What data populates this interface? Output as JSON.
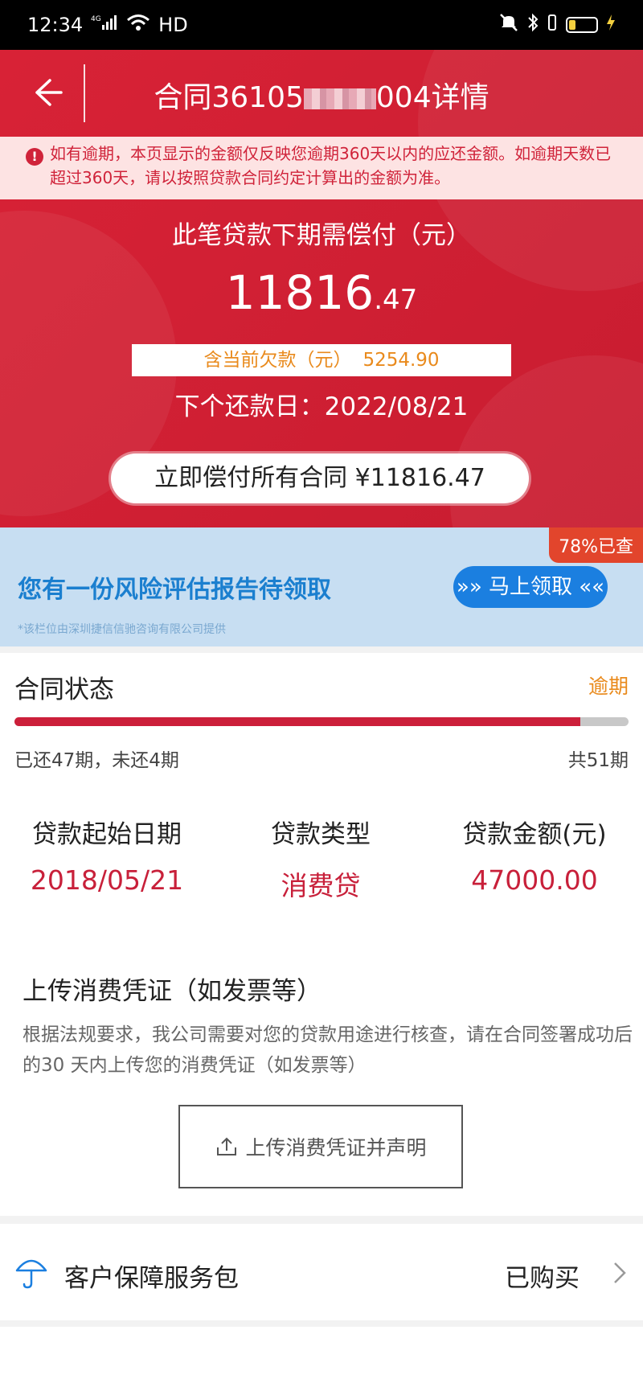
{
  "status_bar": {
    "time": "12:34",
    "network": "HD"
  },
  "header": {
    "title_prefix": "合同36105",
    "title_suffix": "004详情"
  },
  "notice": {
    "text": "如有逾期，本页显示的金额仅反映您逾期360天以内的应还金额。如逾期天数已超过360天，请以按照贷款合同约定计算出的金额为准。"
  },
  "summary": {
    "due_label": "此笔贷款下期需偿付（元）",
    "amount_int": "11816",
    "amount_dec": ".47",
    "arrears_label": "含当前欠款（元）",
    "arrears_value": "5254.90",
    "next_date": "下个还款日：2022/08/21",
    "pay_button": "立即偿付所有合同 ¥11816.47"
  },
  "banner": {
    "tag": "78%已查",
    "title": "您有一份风险评估报告待领取",
    "button": "»» 马上领取 ««",
    "note": "*该栏位由深圳捷信信驰咨询有限公司提供"
  },
  "contract": {
    "title": "合同状态",
    "status": "逾期",
    "progress_fraction": 0.9216,
    "paid_text": "已还47期，未还4期",
    "total_text": "共51期",
    "info": [
      {
        "label": "贷款起始日期",
        "value": "2018/05/21"
      },
      {
        "label": "贷款类型",
        "value": "消费贷"
      },
      {
        "label": "贷款金额(元)",
        "value": "47000.00"
      }
    ]
  },
  "upload": {
    "title": "上传消费凭证（如发票等）",
    "desc": "根据法规要求，我公司需要对您的贷款用途进行核查，请在合同签署成功后的30 天内上传您的消费凭证（如发票等）",
    "button": "上传消费凭证并声明"
  },
  "service": {
    "label": "客户保障服务包",
    "status": "已购买"
  },
  "colors": {
    "primary_red": "#d82236",
    "blue": "#1b7fe0",
    "orange": "#e98a1c"
  },
  "icons": [
    "back-arrow-icon",
    "warning-icon",
    "upload-icon",
    "umbrella-icon",
    "chevron-right-icon"
  ]
}
